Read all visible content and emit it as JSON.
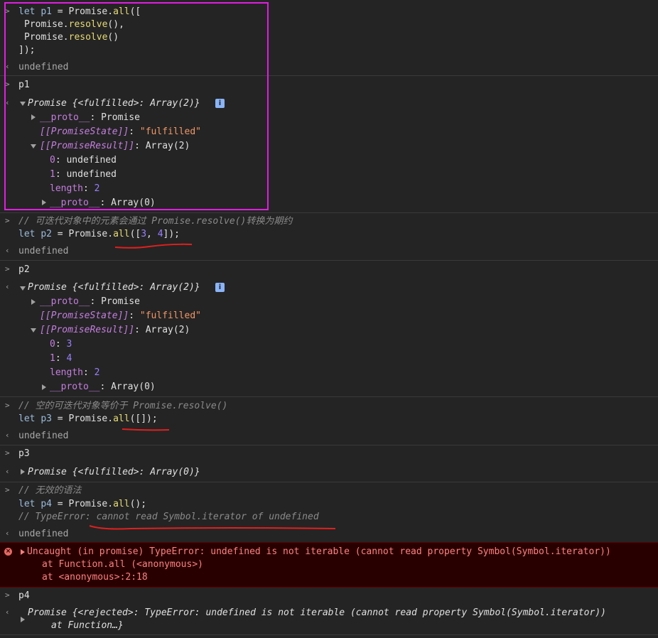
{
  "entries": {
    "e1": {
      "l1a": "let",
      "l1b": "p1",
      "l1c": "=",
      "l1d": "Promise.",
      "l1e": "all",
      "l1f": "([",
      "l2a": "Promise.",
      "l2b": "resolve",
      "l2c": "(),",
      "l3a": "Promise.",
      "l3b": "resolve",
      "l3c": "()",
      "l4": "]);",
      "result": "undefined"
    },
    "e2": {
      "input": "p1",
      "head_a": "Promise",
      "head_b": "{<fulfilled>: Array(2)}",
      "proto_key": "__proto__",
      "proto_val": ": Promise",
      "state_key": "[[PromiseState]]",
      "state_colon": ": ",
      "state_val": "\"fulfilled\"",
      "result_key": "[[PromiseResult]]",
      "result_val": ": Array(2)",
      "i0_key": "0",
      "i0_val": ": undefined",
      "i1_key": "1",
      "i1_val": ": undefined",
      "len_key": "length",
      "len_colon": ": ",
      "len_val": "2",
      "aproto_key": "__proto__",
      "aproto_val": ": Array(0)"
    },
    "e3": {
      "comment": "// 可迭代对象中的元素会通过 Promise.resolve()转换为期约",
      "la": "let",
      "lb": "p2",
      "lc": "=",
      "ld": "Promise.",
      "le": "all",
      "lf": "([",
      "n1": "3",
      "comma": ", ",
      "n2": "4",
      "lg": "]);",
      "result": "undefined"
    },
    "e4": {
      "input": "p2",
      "head_a": "Promise",
      "head_b": "{<fulfilled>: Array(2)}",
      "proto_key": "__proto__",
      "proto_val": ": Promise",
      "state_key": "[[PromiseState]]",
      "state_colon": ": ",
      "state_val": "\"fulfilled\"",
      "result_key": "[[PromiseResult]]",
      "result_val": ": Array(2)",
      "i0_key": "0",
      "i0_colon": ": ",
      "i0_val": "3",
      "i1_key": "1",
      "i1_colon": ": ",
      "i1_val": "4",
      "len_key": "length",
      "len_colon": ": ",
      "len_val": "2",
      "aproto_key": "__proto__",
      "aproto_val": ": Array(0)"
    },
    "e5": {
      "comment": "// 空的可迭代对象等价于 Promise.resolve()",
      "la": "let",
      "lb": "p3",
      "lc": "=",
      "ld": "Promise.",
      "le": "all",
      "lf": "([]);",
      "result": "undefined"
    },
    "e6": {
      "input": "p3",
      "head_a": "Promise",
      "head_b": "{<fulfilled>: Array(0)}"
    },
    "e7": {
      "comment": "// 无效的语法",
      "la": "let",
      "lb": "p4",
      "lc": "=",
      "ld": "Promise.",
      "le": "all",
      "lf": "();",
      "comment2": "// TypeError: cannot read Symbol.iterator of undefined",
      "result": "undefined"
    },
    "error": {
      "line1": "Uncaught (in promise) TypeError: undefined is not iterable (cannot read property Symbol(Symbol.iterator))",
      "line2": "at Function.all (<anonymous>)",
      "line3": "at <anonymous>:2:18",
      "icon": "×"
    },
    "e8": {
      "input": "p4",
      "line1": "Promise {<rejected>: TypeError: undefined is not iterable (cannot read property Symbol(Symbol.iterator))",
      "line2": "at Function…}"
    }
  },
  "icons": {
    "input_prompt": ">",
    "output_prompt": "‹",
    "info": "i"
  },
  "colors": {
    "background": "#242424",
    "highlight_box": "#e01ee0",
    "underline": "#e0201e",
    "error_bg": "#290000"
  }
}
